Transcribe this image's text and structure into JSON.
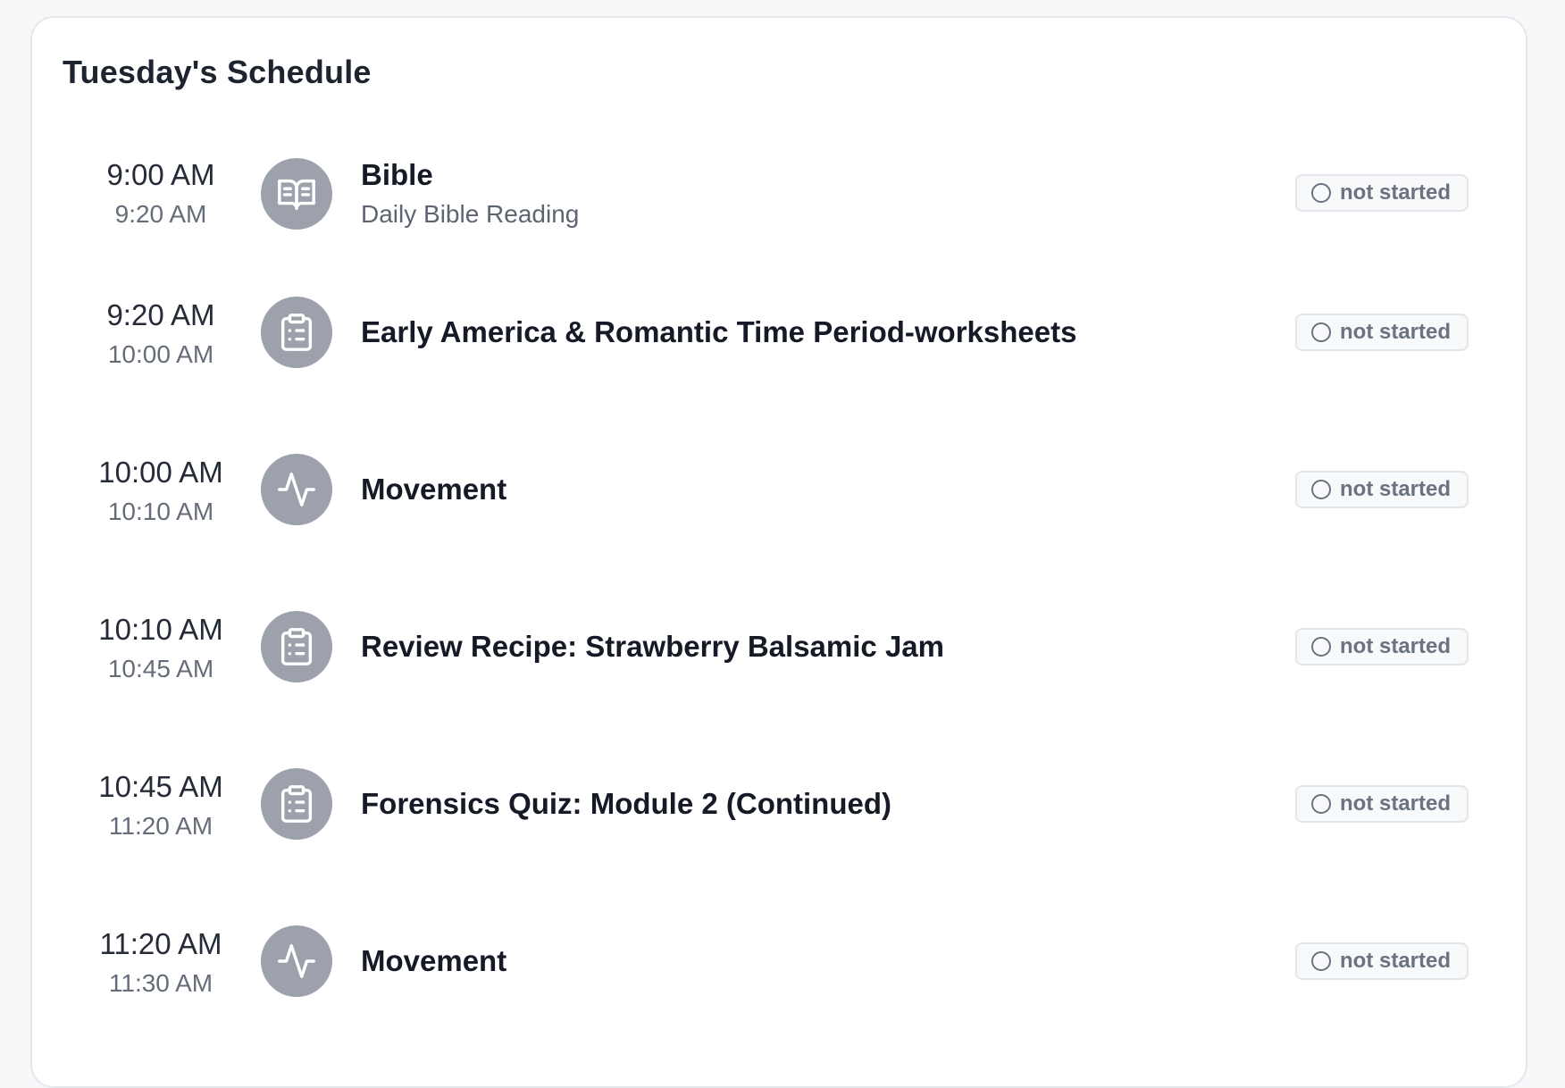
{
  "schedule": {
    "title": "Tuesday's Schedule",
    "items": [
      {
        "start": "9:00 AM",
        "end": "9:20 AM",
        "icon": "book-open-icon",
        "title": "Bible",
        "subtitle": "Daily Bible Reading",
        "status": "not started"
      },
      {
        "start": "9:20 AM",
        "end": "10:00 AM",
        "icon": "clipboard-list-icon",
        "title": "Early America & Romantic Time Period-worksheets",
        "subtitle": "",
        "status": "not started"
      },
      {
        "start": "10:00 AM",
        "end": "10:10 AM",
        "icon": "activity-icon",
        "title": "Movement",
        "subtitle": "",
        "status": "not started"
      },
      {
        "start": "10:10 AM",
        "end": "10:45 AM",
        "icon": "clipboard-list-icon",
        "title": "Review Recipe: Strawberry Balsamic Jam",
        "subtitle": "",
        "status": "not started"
      },
      {
        "start": "10:45 AM",
        "end": "11:20 AM",
        "icon": "clipboard-list-icon",
        "title": "Forensics Quiz: Module 2 (Continued)",
        "subtitle": "",
        "status": "not started"
      },
      {
        "start": "11:20 AM",
        "end": "11:30 AM",
        "icon": "activity-icon",
        "title": "Movement",
        "subtitle": "",
        "status": "not started"
      }
    ]
  },
  "colors": {
    "icon_bg": "#9ca1ab",
    "status_text": "#6b7280"
  }
}
